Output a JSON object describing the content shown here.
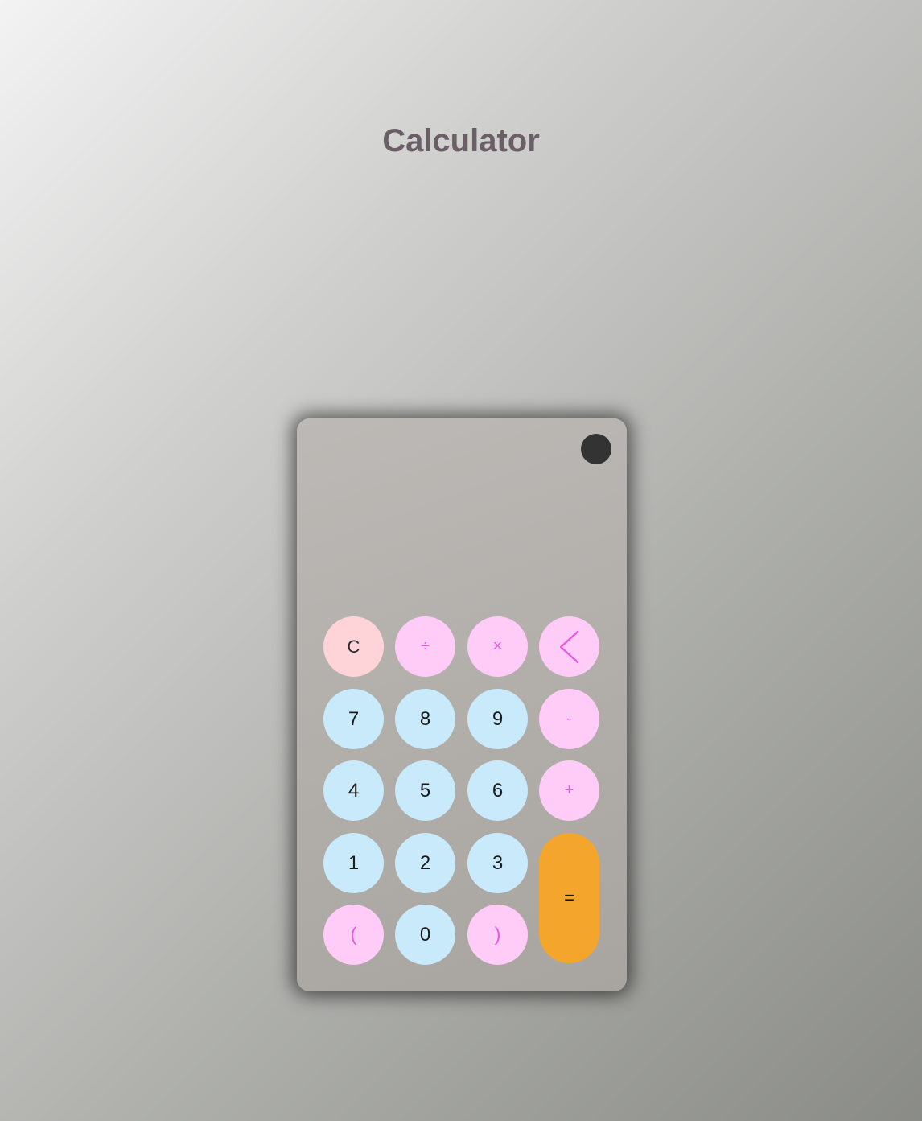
{
  "page": {
    "title": "Calculator"
  },
  "display": {
    "value": ""
  },
  "keys": {
    "clear": "C",
    "divide": "÷",
    "multiply": "×",
    "backspace_icon": "chevron-left-icon",
    "seven": "7",
    "eight": "8",
    "nine": "9",
    "minus": "-",
    "four": "4",
    "five": "5",
    "six": "6",
    "plus": "+",
    "one": "1",
    "two": "2",
    "three": "3",
    "equals": "=",
    "open_paren": "(",
    "zero": "0",
    "close_paren": ")"
  },
  "colors": {
    "number_key": "#c8eafa",
    "operator_key": "#ffccf8",
    "operator_text": "#e65be0",
    "clear_key": "#ffd4d8",
    "equals_key": "#f4a52c",
    "theme_toggle": "#333333",
    "title_text": "#6a5f67"
  }
}
